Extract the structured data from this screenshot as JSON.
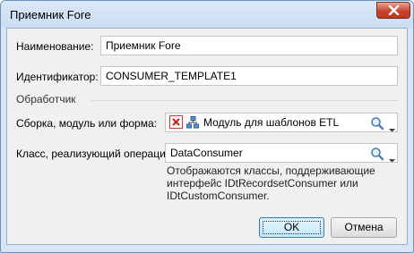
{
  "window": {
    "title": "Приемник Fore"
  },
  "form": {
    "name_label": "Наименование:",
    "name_value": "Приемник Fore",
    "id_label": "Идентификатор:",
    "id_value": "CONSUMER_TEMPLATE1",
    "handler_section": "Обработчик",
    "assembly_label": "Сборка, модуль или форма:",
    "assembly_value": "Модуль для шаблонов ETL",
    "class_label": "Класс, реализующий операции:",
    "class_value": "DataConsumer",
    "hint_lines": [
      "Отображаются классы, поддерживающие",
      "интерфейс IDtRecordsetConsumer или",
      "IDtCustomConsumer."
    ]
  },
  "buttons": {
    "ok": "OK",
    "cancel": "Отмена"
  },
  "colors": {
    "accent": "#3c7fb1",
    "close": "#c7432d"
  }
}
